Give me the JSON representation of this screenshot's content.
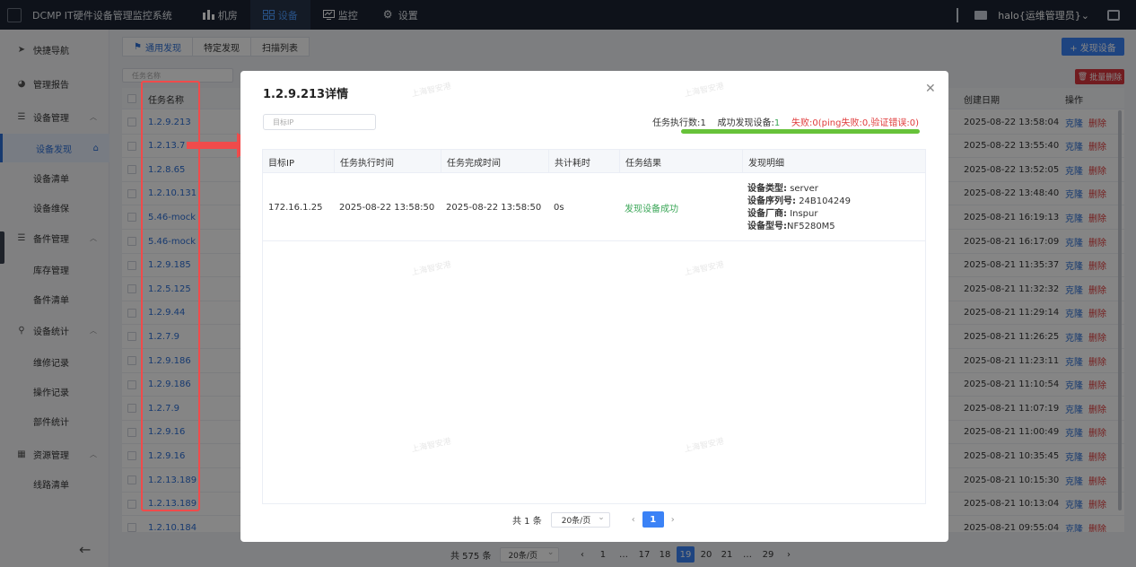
{
  "app": {
    "title": "DCMP IT硬件设备管理监控系统",
    "nav": [
      {
        "label": "机房",
        "icon": "bar-chart-icon",
        "active": false
      },
      {
        "label": "设备",
        "icon": "grid-icon",
        "active": true
      },
      {
        "label": "监控",
        "icon": "monitor-icon",
        "active": false
      },
      {
        "label": "设置",
        "icon": "gear-icon",
        "active": false
      }
    ],
    "user": "halo{运维管理员}"
  },
  "sidebar": {
    "items": [
      {
        "label": "快捷导航",
        "icon": "send-icon",
        "type": "top"
      },
      {
        "label": "管理报告",
        "icon": "pie-icon",
        "type": "top"
      },
      {
        "label": "设备管理",
        "icon": "sliders-icon",
        "type": "group"
      },
      {
        "label": "设备发现",
        "type": "child",
        "active": true
      },
      {
        "label": "设备清单",
        "type": "child"
      },
      {
        "label": "设备维保",
        "type": "child"
      },
      {
        "label": "备件管理",
        "icon": "sliders-icon",
        "type": "group"
      },
      {
        "label": "库存管理",
        "type": "child"
      },
      {
        "label": "备件清单",
        "type": "child"
      },
      {
        "label": "设备统计",
        "icon": "search-icon",
        "type": "group"
      },
      {
        "label": "维修记录",
        "type": "child"
      },
      {
        "label": "操作记录",
        "type": "child"
      },
      {
        "label": "部件统计",
        "type": "child"
      },
      {
        "label": "资源管理",
        "icon": "table-icon",
        "type": "group"
      },
      {
        "label": "线路清单",
        "type": "child"
      }
    ]
  },
  "main": {
    "tabs": [
      {
        "label": "通用发现",
        "active": true
      },
      {
        "label": "特定发现",
        "active": false
      },
      {
        "label": "扫描列表",
        "active": false
      }
    ],
    "add_button": "+ 发现设备",
    "batch_delete": "批量删除",
    "filter_placeholder": "任务名称",
    "table": {
      "headers": {
        "name": "任务名称",
        "created": "创建日期",
        "ops": "操作"
      },
      "op_clone": "克隆",
      "op_delete": "删除",
      "rows": [
        {
          "name": "1.2.9.213",
          "created": "2025-08-22 13:58:04"
        },
        {
          "name": "1.2.13.7",
          "created": "2025-08-22 13:55:40"
        },
        {
          "name": "1.2.8.65",
          "created": "2025-08-22 13:52:05"
        },
        {
          "name": "1.2.10.131",
          "created": "2025-08-22 13:48:40"
        },
        {
          "name": "5.46-mock",
          "created": "2025-08-21 16:19:13"
        },
        {
          "name": "5.46-mock",
          "created": "2025-08-21 16:17:09"
        },
        {
          "name": "1.2.9.185",
          "created": "2025-08-21 11:35:37"
        },
        {
          "name": "1.2.5.125",
          "created": "2025-08-21 11:32:32"
        },
        {
          "name": "1.2.9.44",
          "created": "2025-08-21 11:29:14"
        },
        {
          "name": "1.2.7.9",
          "created": "2025-08-21 11:26:25"
        },
        {
          "name": "1.2.9.186",
          "created": "2025-08-21 11:23:11"
        },
        {
          "name": "1.2.9.186",
          "created": "2025-08-21 11:10:54"
        },
        {
          "name": "1.2.7.9",
          "created": "2025-08-21 11:07:19"
        },
        {
          "name": "1.2.9.16",
          "created": "2025-08-21 11:00:49"
        },
        {
          "name": "1.2.9.16",
          "created": "2025-08-21 10:35:45"
        },
        {
          "name": "1.2.13.189",
          "created": "2025-08-21 10:15:30"
        },
        {
          "name": "1.2.13.189",
          "created": "2025-08-21 10:13:04"
        },
        {
          "name": "1.2.10.184",
          "created": "2025-08-21 09:55:04"
        }
      ]
    },
    "pager": {
      "total": "共 575 条",
      "page_size": "20条/页",
      "pages": [
        "1",
        "…",
        "17",
        "18",
        "19",
        "20",
        "21",
        "…",
        "29"
      ],
      "current": "19",
      "prev": "‹",
      "next": "›"
    }
  },
  "modal": {
    "title": "1.2.9.213详情",
    "target_placeholder": "目标IP",
    "stats": {
      "exec_label": "任务执行数:",
      "exec_value": "1",
      "success_label": "成功发现设备:",
      "success_value": "1",
      "fail_text": "失败:0(ping失败:0,验证错误:0)"
    },
    "progress": 1.0,
    "headers": [
      "目标IP",
      "任务执行时间",
      "任务完成时间",
      "共计耗时",
      "任务结果",
      "发现明细"
    ],
    "row": {
      "ip": "172.16.1.25",
      "exec_time": "2025-08-22 13:58:50",
      "done_time": "2025-08-22 13:58:50",
      "duration": "0s",
      "result": "发现设备成功",
      "detail": [
        {
          "label": "设备类型:",
          "value": "server"
        },
        {
          "label": "设备序列号:",
          "value": "24B104249"
        },
        {
          "label": "设备厂商:",
          "value": "Inspur"
        },
        {
          "label": "设备型号:",
          "value": "NF5280M5"
        }
      ]
    },
    "pager": {
      "total": "共 1 条",
      "page_size": "20条/页",
      "current": "1",
      "prev": "‹",
      "next": "›"
    },
    "watermark": "上海智安港"
  },
  "colors": {
    "accent": "#3b82f6",
    "danger": "#e03b3b",
    "success": "#3aa657",
    "highlight": "#f04b4b"
  }
}
